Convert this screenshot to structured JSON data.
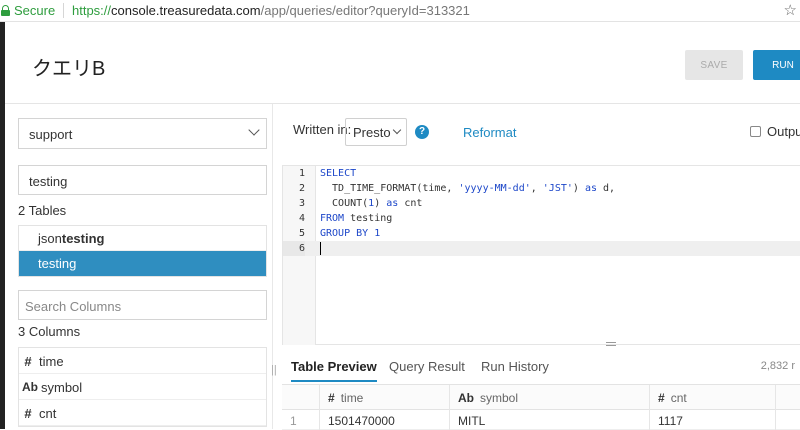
{
  "browser": {
    "secure_label": "Secure",
    "url_prefix": "https://",
    "url_host": "console.treasuredata.com",
    "url_path": "/app/queries/editor?queryId=313321"
  },
  "header": {
    "title": "クエリB",
    "save_label": "SAVE",
    "run_label": "RUN"
  },
  "sidebar": {
    "database": "support",
    "table_search": "testing",
    "table_count": "2 Tables",
    "tables": [
      {
        "prefix": "json",
        "match": "testing"
      },
      {
        "prefix": "",
        "match": "testing"
      }
    ],
    "column_search_placeholder": "Search Columns",
    "column_count": "3 Columns",
    "columns": [
      {
        "type": "#",
        "name": "time"
      },
      {
        "type": "Ab",
        "name": "symbol"
      },
      {
        "type": "#",
        "name": "cnt"
      }
    ]
  },
  "toolbar": {
    "written_in": "Written in:",
    "language": "Presto",
    "help": "?",
    "reformat": "Reformat",
    "output": "Output"
  },
  "editor": {
    "line_numbers": [
      "1",
      "2",
      "3",
      "4",
      "5",
      "6"
    ]
  },
  "results": {
    "tabs": [
      "Table Preview",
      "Query Result",
      "Run History"
    ],
    "row_count": "2,832 r",
    "headers": [
      {
        "type": "#",
        "name": "time"
      },
      {
        "type": "Ab",
        "name": "symbol"
      },
      {
        "type": "#",
        "name": "cnt"
      }
    ],
    "rows": [
      {
        "num": "1",
        "time": "1501470000",
        "symbol": "MITL",
        "cnt": "1117"
      }
    ]
  }
}
